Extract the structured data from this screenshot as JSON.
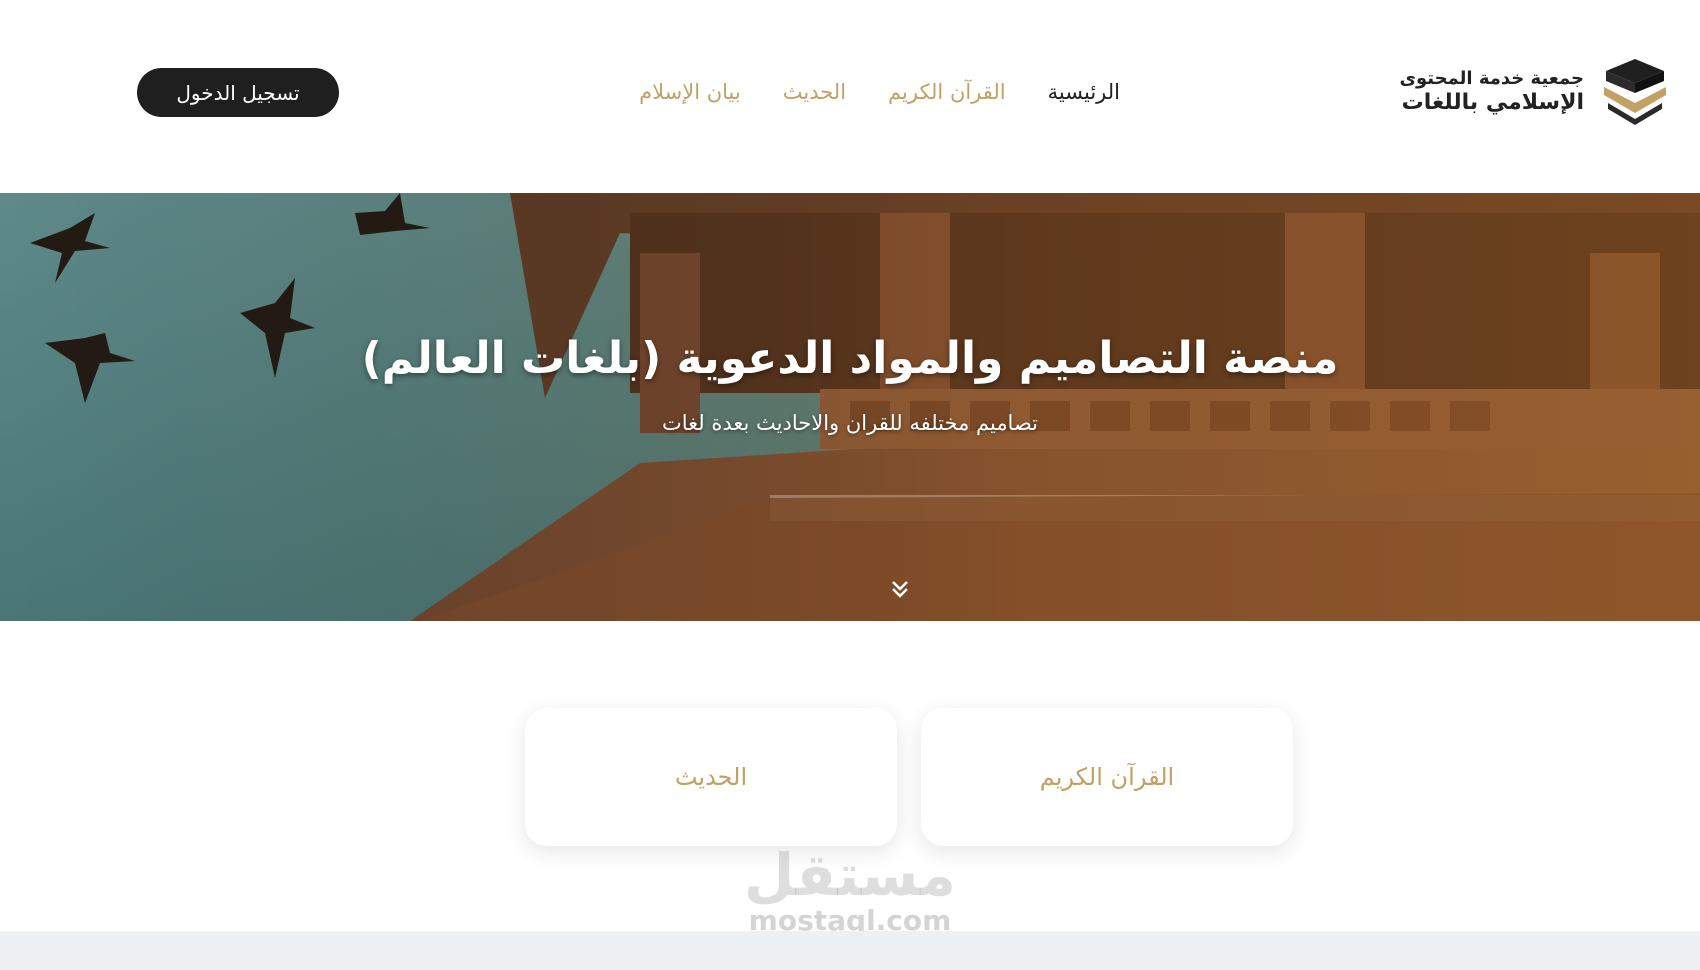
{
  "header": {
    "login_label": "تسجيل الدخول",
    "nav": [
      {
        "label": "الرئيسية",
        "active": true
      },
      {
        "label": "القرآن الكريم",
        "active": false
      },
      {
        "label": "الحديث",
        "active": false
      },
      {
        "label": "بيان الإسلام",
        "active": false
      }
    ],
    "logo": {
      "line1": "جمعية خدمة المحتوى",
      "line2": "الإسلامي باللغات"
    }
  },
  "hero": {
    "title": "منصة التصاميم والمواد الدعوية (بلغات العالم)",
    "subtitle": "تصاميم مختلفه للقران والاحاديث بعدة لغات",
    "scroll_icon": "double-chevron-down-icon"
  },
  "cards": [
    {
      "label": "القرآن الكريم"
    },
    {
      "label": "الحديث"
    }
  ],
  "watermark": {
    "arabic": "مستقل",
    "latin": "mostaql.com"
  },
  "colors": {
    "accent_gold": "#c3a063",
    "dark": "#1f1f1f",
    "footer_band": "#eef1f4"
  }
}
